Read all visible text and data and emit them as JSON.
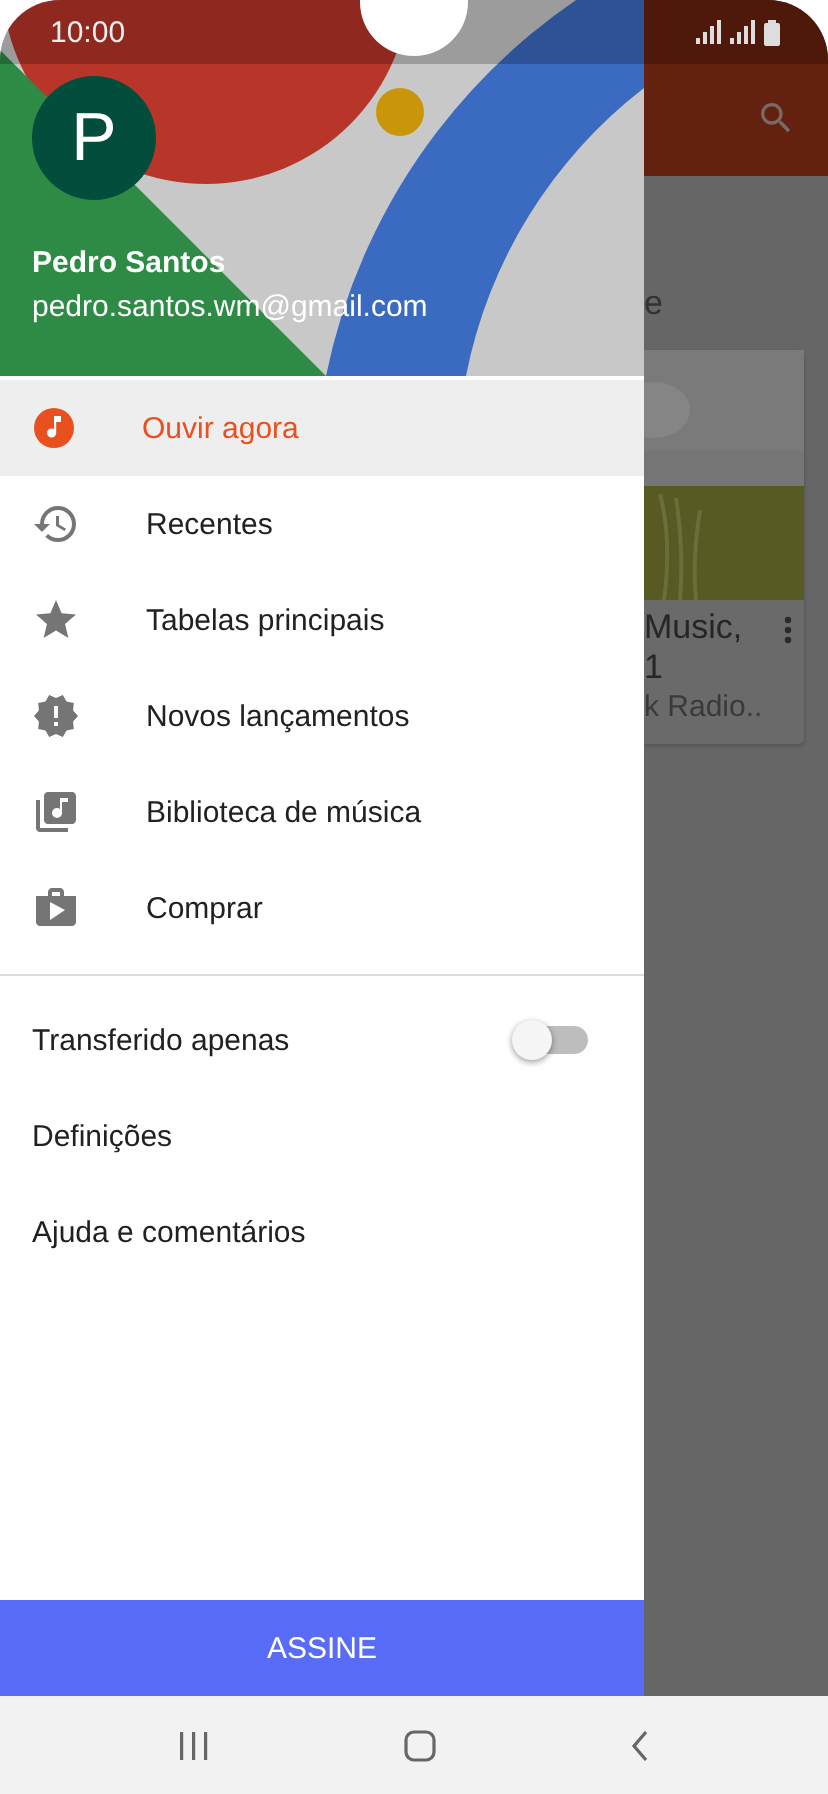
{
  "status_bar": {
    "time": "10:00"
  },
  "app_behind": {
    "section_heading": "e",
    "card": {
      "title_lines": [
        "Music,",
        "1"
      ],
      "subtitle": "k Radio.."
    }
  },
  "drawer": {
    "account": {
      "initial": "P",
      "name": "Pedro Santos",
      "email": "pedro.santos.wm@gmail.com"
    },
    "nav_items": [
      {
        "label": "Ouvir agora",
        "selected": true
      },
      {
        "label": "Recentes",
        "selected": false
      },
      {
        "label": "Tabelas principais",
        "selected": false
      },
      {
        "label": "Novos lançamentos",
        "selected": false
      },
      {
        "label": "Biblioteca de música",
        "selected": false
      },
      {
        "label": "Comprar",
        "selected": false
      }
    ],
    "settings": [
      {
        "kind": "toggle",
        "label": "Transferido apenas",
        "on": false
      },
      {
        "kind": "link",
        "label": "Definições"
      },
      {
        "kind": "link",
        "label": "Ajuda e comentários"
      }
    ],
    "subscribe_button": "ASSINE"
  }
}
